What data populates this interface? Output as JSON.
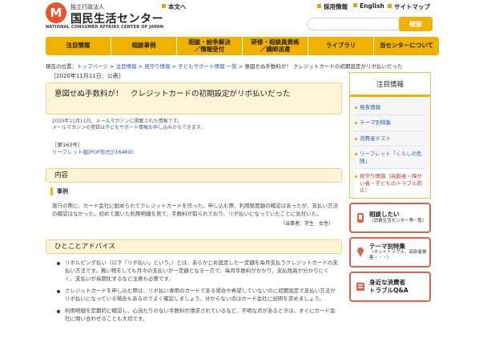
{
  "header": {
    "logo_mark": "M",
    "logo_sub": "独立行政法人",
    "logo_main": "国民生活センター",
    "logo_en": "NATIONAL CONSUMER AFFAIRS CENTER OF JAPAN",
    "link_honbun": "本文へ",
    "link_saiyo": "採用情報",
    "link_english": "English",
    "link_sitemap": "サイトマップ",
    "search_placeholder": "",
    "search_label": "検索",
    "accent_color": "#f0b100",
    "brand_color": "#e8552c"
  },
  "nav": {
    "items": [
      {
        "label": "注目情報"
      },
      {
        "label": "相談事例"
      },
      {
        "label": "相談・紛争解決\n／情報受付"
      },
      {
        "label": "研修・相談員資格\n／講師派遣"
      },
      {
        "label": "ライブラリ"
      },
      {
        "label": "当センターについて"
      }
    ]
  },
  "breadcrumb": {
    "prefix": "現在の位置：",
    "items": [
      "トップページ",
      "注目情報",
      "見守り情報",
      "子どもサポート情報 一覧"
    ],
    "separator": " > ",
    "current": "意図せぬ手数料が！ クレジットカードの初期設定がリボ払いだった"
  },
  "article": {
    "date": "［2020年11月11日：公表］",
    "title": "意図せぬ手数料が！　クレジットカードの初期設定がリボ払いだった",
    "meta_line1": "2020年11月11日、メールマガジンに掲載された情報です。",
    "meta_line2_pre": "メールマガジンの登録は",
    "meta_line2_link": "子どもサポート情報お申し込み",
    "meta_line2_post": "からできます。",
    "issue_no": "［第163号］",
    "leaflet_link": "リーフレット版[PDF形式](164KB)",
    "content_heading": "内容",
    "case_heading": "事例",
    "case_text": "旅行の際に、カード会社に勧められてクレジットカードを作った。申し込む際、利用限度額の確認はあったが、支払い方法の確認はなかった。初めて届いた利用明細を見て、手数料が取られており、リボ払いになっていたことに気付いた。",
    "case_source": "（当事者：学生　女性）",
    "advice_heading": "ひとことアドバイス",
    "advice": [
      "リボルビング払い（以下「リボ払い」という。）とは、あらかじめ設定した一定額を毎月支払うクレジットカードの支払い方法です。買い物をしても月々の支払いが一定額となる一方で、毎月手数料がかかり、支払残高が分かりにくく、支払いが長期化するなど注意も必要です。",
      "クレジットカードを申し込む際は、リボ払い専用のカードである場合や希望していないのに初期設定で支払い方法がリボ払いになっている場合もあるのでよく確認しましょう。分からない点はカード会社に説明を求めましょう。",
      "利用明細を定期的に確認し、心当たりのない手数料が請求されているなど、不明な点があるときは、すぐにカード会社に問い合わせることも大切です。"
    ]
  },
  "sidebar": {
    "title": "注目情報",
    "items": [
      {
        "label": "発表情報"
      },
      {
        "label": "テーマ別特集"
      },
      {
        "label": "消費者テスト"
      },
      {
        "label": "リーフレット「くらしの危険」"
      },
      {
        "label": "見守り情報（高齢者・障がい者・子どものトラブル防止）"
      }
    ],
    "cta": [
      {
        "icon": "phone-icon",
        "title": "相談したい",
        "sub": "（消費生活センター等一覧）"
      },
      {
        "icon": "pin-icon",
        "title": "テーマ別特集",
        "sub": "（ネットトラブル、高齢者被害・・・）"
      },
      {
        "icon": "book-icon",
        "title": "身近な消費者\nトラブルQ&A",
        "sub": ""
      }
    ]
  }
}
